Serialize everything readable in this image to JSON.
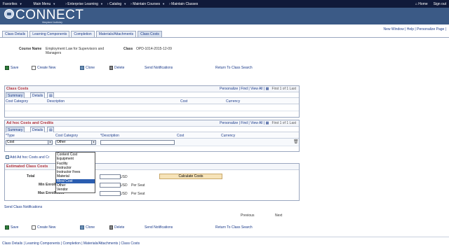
{
  "topnav": {
    "crumbs": [
      "Favorites",
      "Main Menu",
      "Enterprise Learning",
      "Catalog",
      "Maintain Courses",
      "Maintain Classes"
    ],
    "home": "Home",
    "signout": "Sign out"
  },
  "banner": {
    "brand": "CONNECT",
    "subtitle": "Maryland Judiciary"
  },
  "tabs": [
    "Class Details",
    "Learning Components",
    "Completion",
    "Materials/Attachments",
    "Class Costs"
  ],
  "toplinks": "New Window | Help | Personalize Page |",
  "course": {
    "name_label": "Course Name",
    "name_value": "Employment Law for Supervisors and Managers",
    "class_label": "Class",
    "class_value": "OPD-1014-2015-12-09"
  },
  "toolbar": {
    "save": "Save",
    "create_new": "Create New",
    "clone": "Clone",
    "delete": "Delete",
    "send_notifications": "Send Notifications",
    "return": "Return To Class Search"
  },
  "class_costs": {
    "title": "Class Costs",
    "nav": "Personalize | Find | View All |",
    "pager": "First  1 of 1  Last",
    "tabs": [
      "Summary",
      "Details"
    ],
    "columns": [
      "Cost Category",
      "Description",
      "Cost",
      "Currency"
    ]
  },
  "adhoc": {
    "title": "Ad hoc Costs and Credits",
    "nav": "Personalize | Find | View All |",
    "pager": "First  1 of 1  Last",
    "tabs": [
      "Summary",
      "Details"
    ],
    "columns": [
      "*Type",
      "Cost Category",
      "*Description",
      "Cost",
      "Currency"
    ],
    "type_value": "Cost",
    "category_value": "Other",
    "add_link": "Add Ad hoc Costs and Cr",
    "dropdown_options": [
      "Content Cost",
      "Equipment",
      "Facility",
      "Instructor",
      "Instructor Fees",
      "Material",
      "Meal Cost",
      "Other",
      "Vendor"
    ],
    "dropdown_selected": "Meal Cost"
  },
  "estimated": {
    "title": "Estimated Class Costs",
    "total_label": "Total",
    "min_label": "Min Enrollment",
    "max_label": "Max Enrollment",
    "currency": "USD",
    "per_seat": "Per Seat",
    "calc_button": "Calculate Costs"
  },
  "send_link": "Send Class Notifications",
  "pager_prev": "Previous",
  "pager_next": "Next",
  "footer": "Class Details | Learning Components | Completion | Materials/Attachments | Class Costs"
}
